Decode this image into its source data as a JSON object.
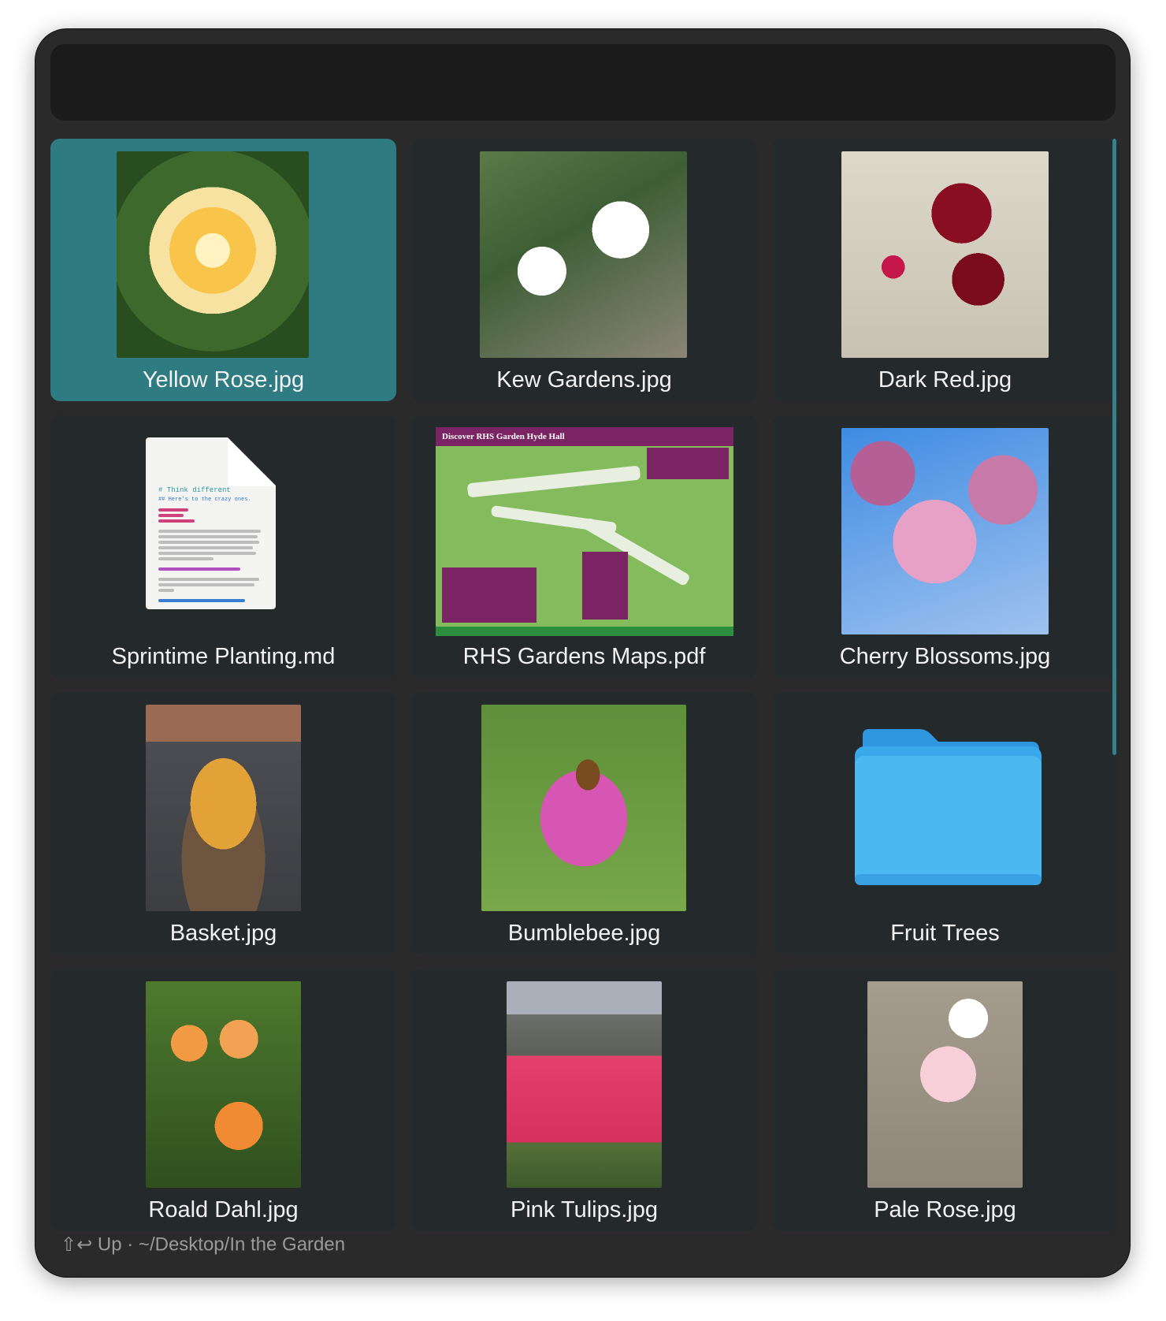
{
  "search": {
    "value": "",
    "placeholder": ""
  },
  "items": [
    {
      "label": "Yellow Rose.jpg",
      "kind": "image",
      "selected": true
    },
    {
      "label": "Kew Gardens.jpg",
      "kind": "image",
      "selected": false
    },
    {
      "label": "Dark Red.jpg",
      "kind": "image",
      "selected": false
    },
    {
      "label": "Sprintime Planting.md",
      "kind": "markdown-document",
      "selected": false
    },
    {
      "label": "RHS Gardens Maps.pdf",
      "kind": "pdf-document",
      "selected": false
    },
    {
      "label": "Cherry Blossoms.jpg",
      "kind": "image",
      "selected": false
    },
    {
      "label": "Basket.jpg",
      "kind": "image",
      "selected": false
    },
    {
      "label": "Bumblebee.jpg",
      "kind": "image",
      "selected": false
    },
    {
      "label": "Fruit Trees",
      "kind": "folder",
      "selected": false
    },
    {
      "label": "Roald Dahl.jpg",
      "kind": "image",
      "selected": false
    },
    {
      "label": "Pink Tulips.jpg",
      "kind": "image",
      "selected": false
    },
    {
      "label": "Pale Rose.jpg",
      "kind": "image",
      "selected": false
    }
  ],
  "doc_preview": {
    "title": "# Think different",
    "subtitle": "## Here's to the crazy ones."
  },
  "pdf_preview": {
    "title": "Discover RHS Garden Hyde Hall"
  },
  "footer": {
    "shortcut": "⇧↩",
    "action": "Up",
    "separator": "·",
    "path": "~/Desktop/In the Garden"
  },
  "colors": {
    "window_bg": "#2a2a2b",
    "tile_bg": "#242a2b",
    "selected_tile": "#2e7b82",
    "folder_blue": "#46b3f0",
    "scrollbar": "#35808a"
  },
  "icons": [
    "folder-icon",
    "markdown-document-icon",
    "pdf-document-icon",
    "return-shift-icon"
  ]
}
